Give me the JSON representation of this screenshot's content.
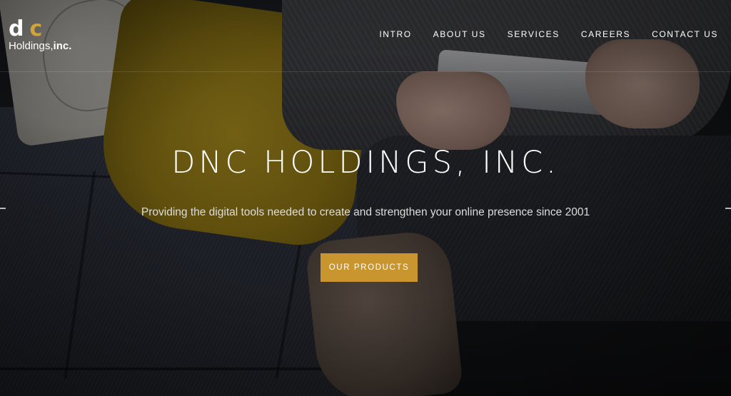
{
  "brand": {
    "logo_d": "d",
    "logo_c": "c",
    "logo_holdings": "Holdings,",
    "logo_inc": "inc."
  },
  "nav": {
    "items": [
      {
        "label": "INTRO"
      },
      {
        "label": "ABOUT US"
      },
      {
        "label": "SERVICES"
      },
      {
        "label": "CAREERS"
      },
      {
        "label": "CONTACT US"
      }
    ]
  },
  "hero": {
    "title": "DNC HOLDINGS, INC.",
    "subtitle": "Providing the digital tools needed to create and strengthen your online presence since 2001",
    "cta_label": "OUR PRODUCTS"
  },
  "colors": {
    "accent": "#c9952e",
    "logo_c": "#d2a33a",
    "text": "#ffffff"
  },
  "icons": {
    "slider_prev": "chevron-left-icon",
    "slider_next": "chevron-right-icon"
  }
}
